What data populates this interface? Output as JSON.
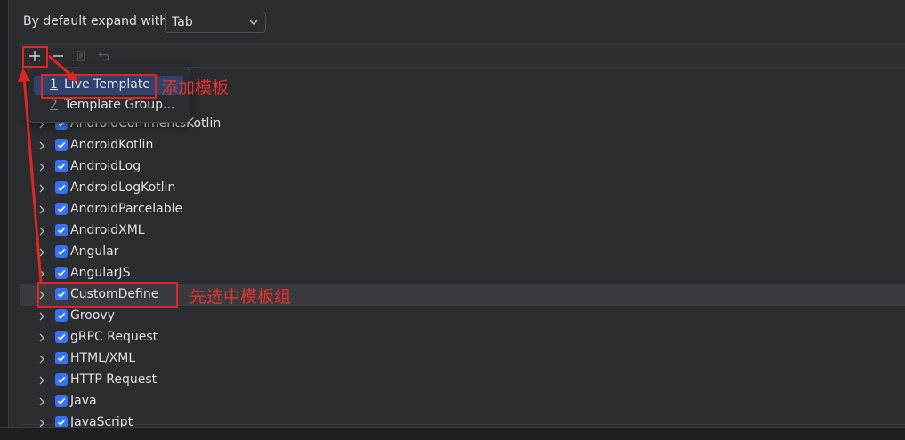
{
  "settings": {
    "expand_label": "By default expand with",
    "expand_value": "Tab"
  },
  "toolbar": {
    "add_icon": "plus-icon",
    "remove_icon": "minus-icon",
    "copy_icon": "copy-icon",
    "revert_icon": "undo-icon"
  },
  "popup": {
    "items": [
      {
        "mnemonic": "1",
        "label": "Live Template"
      },
      {
        "mnemonic": "2",
        "label": "Template Group..."
      }
    ]
  },
  "tree": {
    "items": [
      {
        "label": "AndroidCommentsKotlin",
        "checked": true
      },
      {
        "label": "AndroidKotlin",
        "checked": true
      },
      {
        "label": "AndroidLog",
        "checked": true
      },
      {
        "label": "AndroidLogKotlin",
        "checked": true
      },
      {
        "label": "AndroidParcelable",
        "checked": true
      },
      {
        "label": "AndroidXML",
        "checked": true
      },
      {
        "label": "Angular",
        "checked": true
      },
      {
        "label": "AngularJS",
        "checked": true
      },
      {
        "label": "CustomDefine",
        "checked": true,
        "selected": true
      },
      {
        "label": "Groovy",
        "checked": true
      },
      {
        "label": "gRPC Request",
        "checked": true
      },
      {
        "label": "HTML/XML",
        "checked": true
      },
      {
        "label": "HTTP Request",
        "checked": true
      },
      {
        "label": "Java",
        "checked": true
      },
      {
        "label": "JavaScript",
        "checked": true
      }
    ]
  },
  "annotations": {
    "add_template": "添加模板",
    "select_group_first": "先选中模板组",
    "color": "#e02525"
  },
  "colors": {
    "background": "#2b2d30",
    "checkbox": "#3574f0",
    "selection": "#393b40",
    "popup_highlight": "#2e436e"
  }
}
